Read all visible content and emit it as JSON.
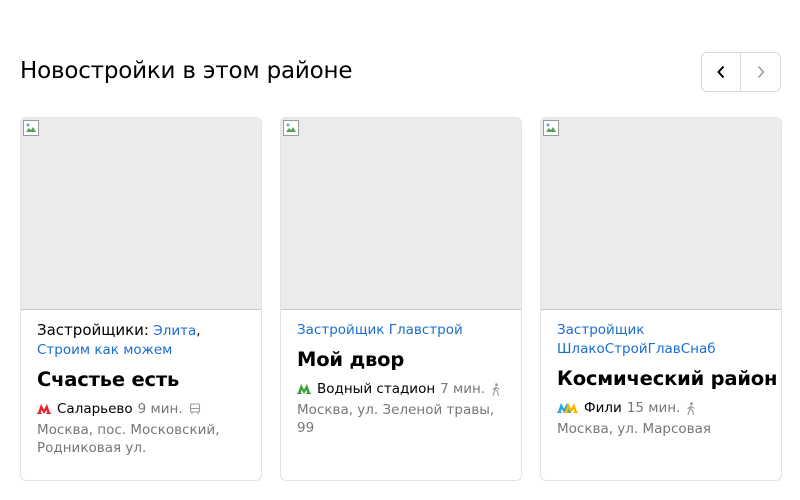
{
  "section": {
    "title": "Новостройки в этом районе"
  },
  "nav": {
    "prev_label": "‹",
    "next_label": "›"
  },
  "cards": [
    {
      "developer_prefix": "Застройщики:",
      "developers": [
        "Элита",
        "Строим как можем"
      ],
      "separator": ",",
      "name": "Счастье есть",
      "metro": {
        "station": "Саларьево",
        "time": "9 мин.",
        "transport": "bus-icon",
        "line_color": "#e4262b"
      },
      "address": "Москва, пос. Московский, Родниковая ул."
    },
    {
      "developer_prefix": "Застройщик",
      "developers": [
        "Главстрой"
      ],
      "name": "Мой двор",
      "metro": {
        "station": "Водный стадион",
        "time": "7 мин.",
        "transport": "walk-icon",
        "line_color": "#3ba134"
      },
      "address": "Москва, ул. Зеленой травы, 99"
    },
    {
      "developer_prefix": "Застройщик",
      "developers": [
        "ШлакоСтройГлавСнаб"
      ],
      "name": "Космический район",
      "metro": {
        "station": "Фили",
        "time": "15 мин.",
        "transport": "walk-icon",
        "line_colors": [
          "#2aa6e0",
          "#f5b800"
        ]
      },
      "address": "Москва, ул. Марсовая"
    }
  ]
}
